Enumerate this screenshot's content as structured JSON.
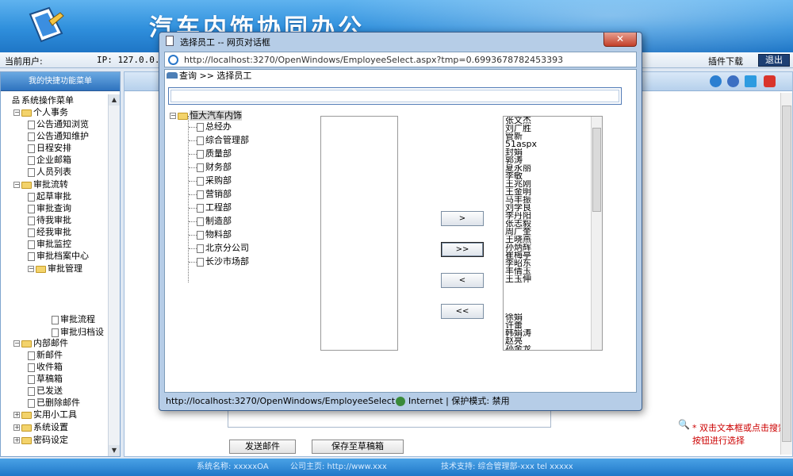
{
  "app": {
    "title": "汽车内饰协同办公",
    "current_user_label": "当前用户:",
    "ip_text": "IP: 127.0.0.1",
    "plugin_download": "插件下载",
    "logout": "退出"
  },
  "sidebar": {
    "header": "我的快捷功能菜单",
    "items": [
      {
        "label": "系统操作菜单",
        "type": "root"
      },
      {
        "label": "个人事务",
        "type": "folder"
      },
      {
        "label": "公告通知浏览",
        "type": "page"
      },
      {
        "label": "公告通知维护",
        "type": "page"
      },
      {
        "label": "日程安排",
        "type": "page"
      },
      {
        "label": "企业邮箱",
        "type": "page"
      },
      {
        "label": "人员列表",
        "type": "page"
      },
      {
        "label": "审批流转",
        "type": "folder"
      },
      {
        "label": "起草审批",
        "type": "page"
      },
      {
        "label": "审批查询",
        "type": "page"
      },
      {
        "label": "待我审批",
        "type": "page"
      },
      {
        "label": "经我审批",
        "type": "page"
      },
      {
        "label": "审批监控",
        "type": "page"
      },
      {
        "label": "审批档案中心",
        "type": "page"
      },
      {
        "label": "审批管理",
        "type": "folder"
      },
      {
        "label": "审批流程",
        "type": "page"
      },
      {
        "label": "审批归档设",
        "type": "page"
      },
      {
        "label": "内部邮件",
        "type": "folder"
      },
      {
        "label": "新邮件",
        "type": "page"
      },
      {
        "label": "收件箱",
        "type": "page"
      },
      {
        "label": "草稿箱",
        "type": "page"
      },
      {
        "label": "已发送",
        "type": "page"
      },
      {
        "label": "已删除邮件",
        "type": "page"
      },
      {
        "label": "实用小工具",
        "type": "folder"
      },
      {
        "label": "系统设置",
        "type": "folder"
      },
      {
        "label": "密码设定",
        "type": "folder"
      }
    ]
  },
  "content": {
    "hint": "* 双击文本框或点击搜索按钮进行选择",
    "send_button": "发送邮件",
    "save_draft_button": "保存至草稿箱"
  },
  "footer": {
    "system_name": "系统名称: xxxxxOA",
    "homepage": "公司主页: http://www.xxx",
    "support": "技术支持: 综合管理部-xxx tel xxxxx"
  },
  "dialog": {
    "title": "选择员工 -- 网页对话框",
    "close": "✕",
    "url": "http://localhost:3270/OpenWindows/EmployeeSelect.aspx?tmp=0.6993678782453393",
    "breadcrumb": "查询 >> 选择员工",
    "org_root": "恒大汽车内饰",
    "departments": [
      "总经办",
      "综合管理部",
      "质量部",
      "财务部",
      "采购部",
      "营销部",
      "工程部",
      "制造部",
      "物料部",
      "北京分公司",
      "长沙市场部"
    ],
    "buttons": {
      "add": ">",
      "add_all": ">>",
      "remove": "<",
      "remove_all": "<<"
    },
    "selected_top": [
      "张文杰",
      "刘广胜",
      "管新",
      "51aspx",
      "封娟",
      "郭涛",
      "夏永丽",
      "李敏",
      "王兆刚",
      "王金明",
      "马丰振",
      "刘学良",
      "李丹阳",
      "张志毅",
      "周广奎",
      "王晓燕",
      "孙炳辉",
      "崔梅亭",
      "李昭东",
      "丰倩玉",
      "王玉伸"
    ],
    "selected_bottom": [
      "徐娟",
      "许蕾",
      "韩娟涛",
      "赵亮",
      "孙金龙"
    ],
    "status_url": "http://localhost:3270/OpenWindows/EmployeeSelect",
    "status_zone": "Internet | 保护模式: 禁用"
  }
}
